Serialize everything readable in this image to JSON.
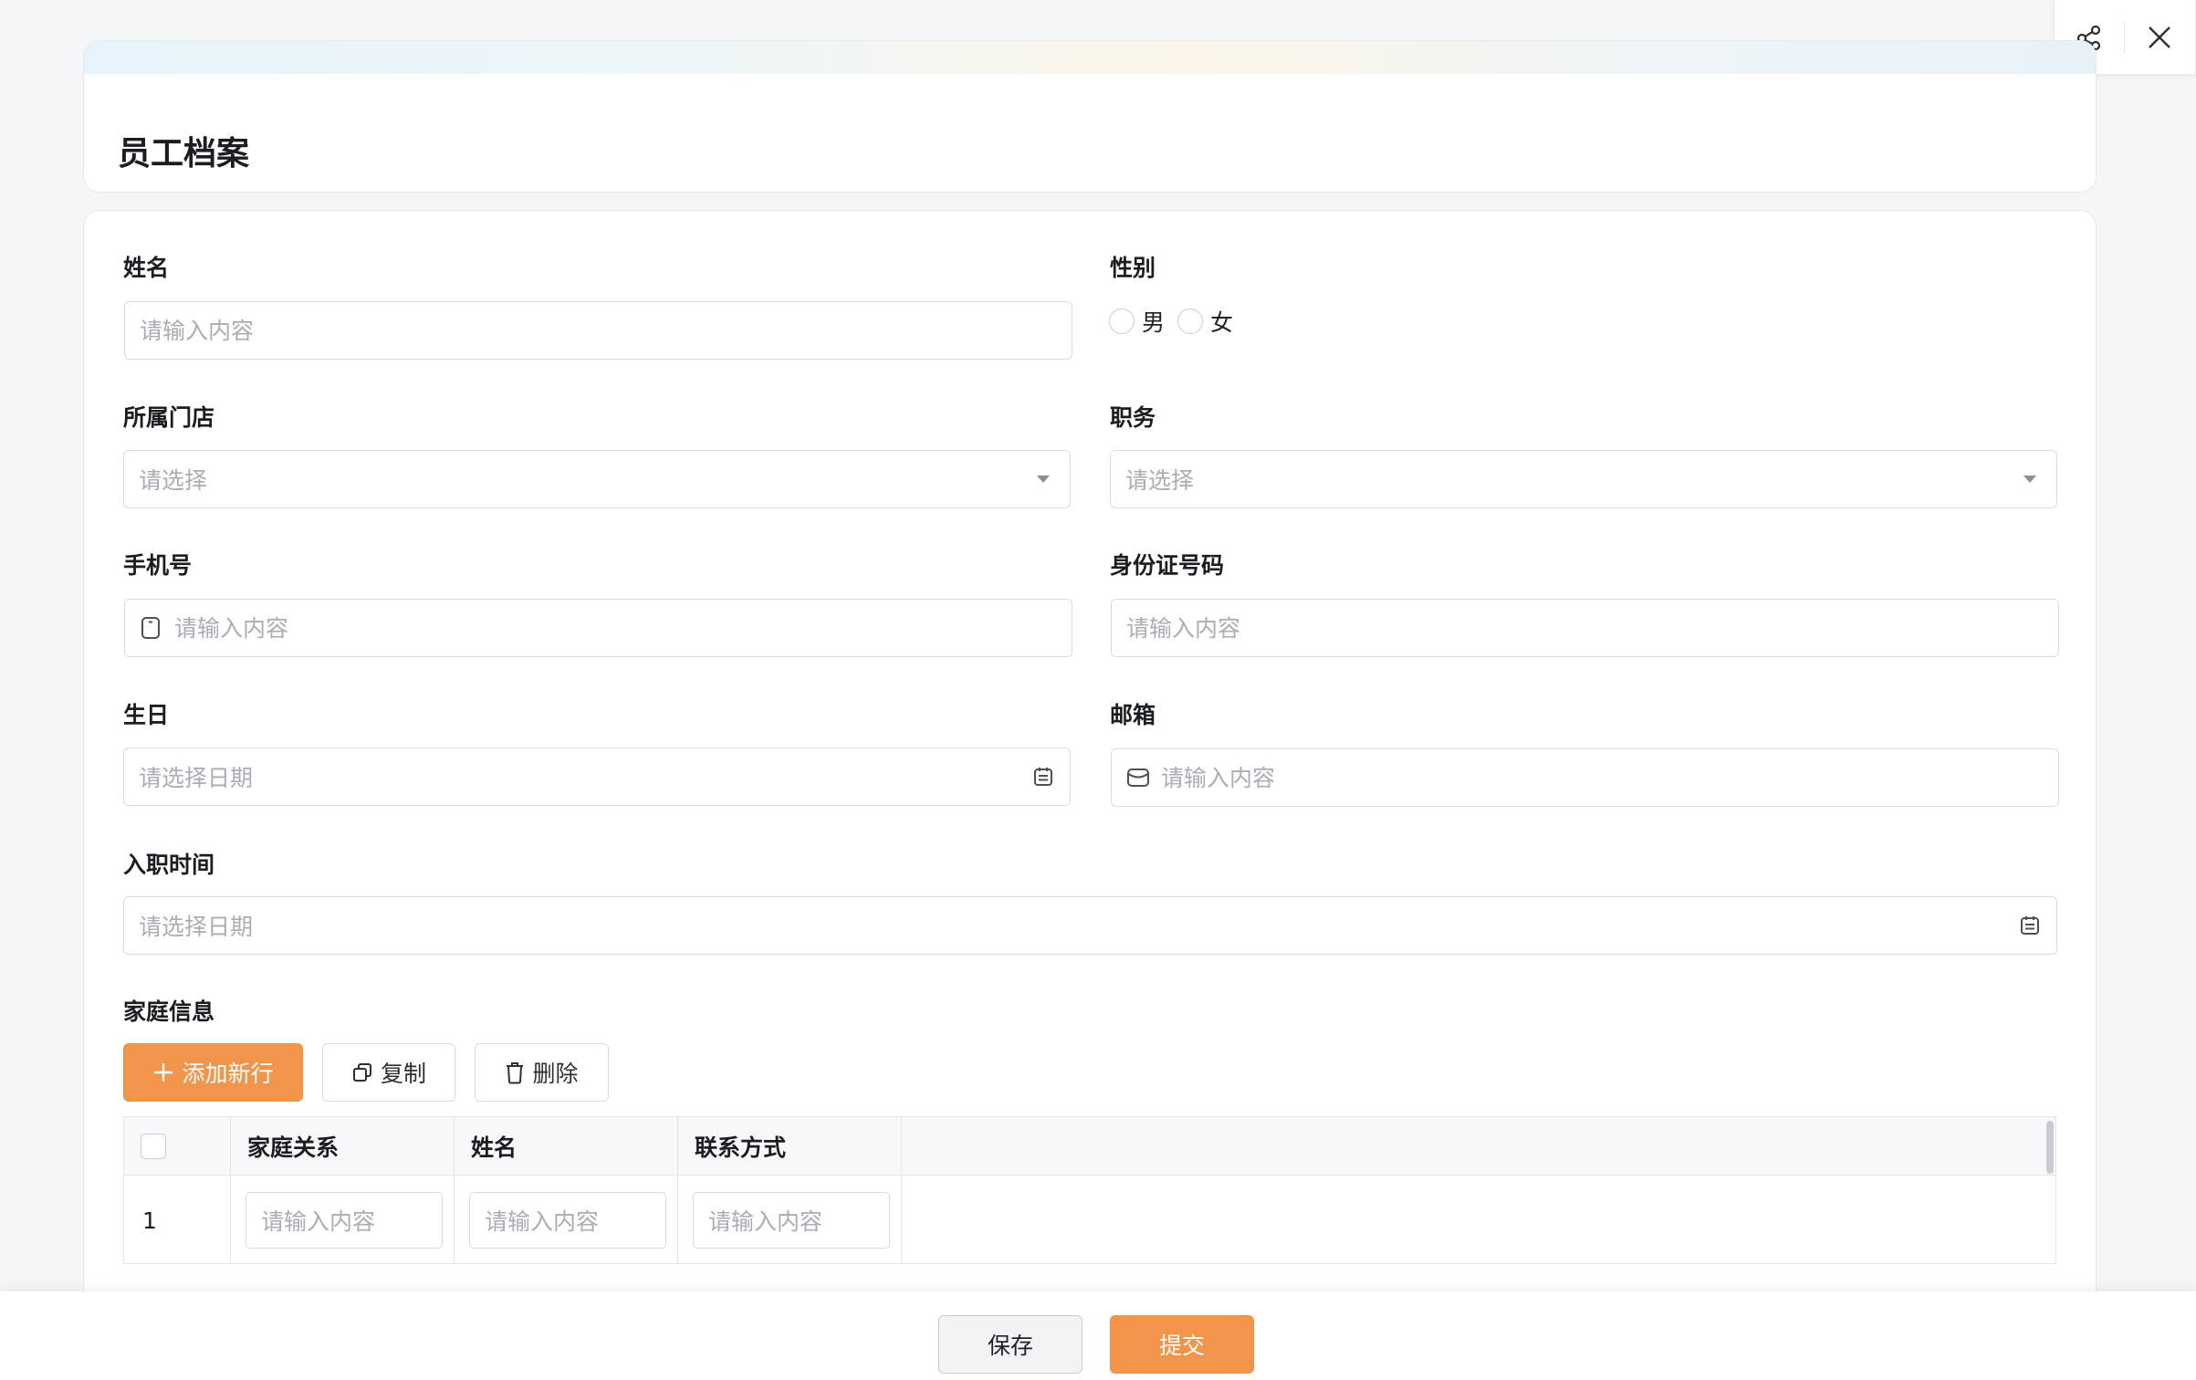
{
  "header": {
    "title": "员工档案"
  },
  "actions": {
    "share_icon": "share-icon",
    "close_icon": "close-icon"
  },
  "form": {
    "name": {
      "label": "姓名",
      "placeholder": "请输入内容"
    },
    "gender": {
      "label": "性别",
      "options": [
        "男",
        "女"
      ]
    },
    "store": {
      "label": "所属门店",
      "placeholder": "请选择"
    },
    "position": {
      "label": "职务",
      "placeholder": "请选择"
    },
    "phone": {
      "label": "手机号",
      "placeholder": "请输入内容",
      "icon": "phone-icon"
    },
    "id_number": {
      "label": "身份证号码",
      "placeholder": "请输入内容"
    },
    "birthday": {
      "label": "生日",
      "placeholder": "请选择日期",
      "icon": "calendar-icon"
    },
    "email": {
      "label": "邮箱",
      "placeholder": "请输入内容",
      "icon": "mail-icon"
    },
    "hire_date": {
      "label": "入职时间",
      "placeholder": "请选择日期",
      "icon": "calendar-icon"
    }
  },
  "family": {
    "label": "家庭信息",
    "toolbar": {
      "add_label": "添加新行",
      "copy_label": "复制",
      "delete_label": "删除"
    },
    "columns": [
      "家庭关系",
      "姓名",
      "联系方式"
    ],
    "rows": [
      {
        "index": "1",
        "relation_placeholder": "请输入内容",
        "name_placeholder": "请输入内容",
        "contact_placeholder": "请输入内容"
      }
    ]
  },
  "footer": {
    "save_label": "保存",
    "submit_label": "提交"
  },
  "colors": {
    "primary": "#f0954a",
    "border": "#d9dce1",
    "placeholder": "#a9adb5"
  }
}
